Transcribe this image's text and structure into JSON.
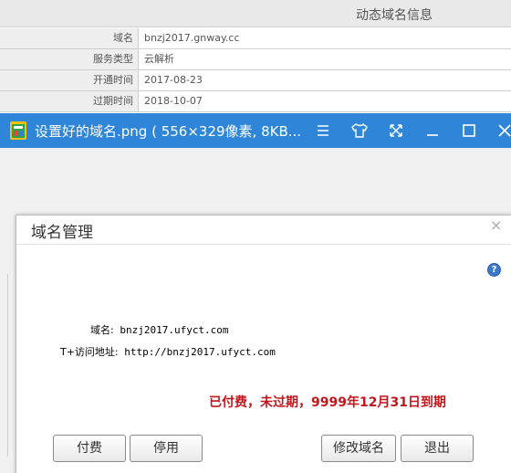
{
  "info_table": {
    "header": "动态域名信息",
    "rows": [
      {
        "label": "域名",
        "value": "bnzj2017.gnway.cc"
      },
      {
        "label": "服务类型",
        "value": "云解析"
      },
      {
        "label": "开通时间",
        "value": "2017-08-23"
      },
      {
        "label": "过期时间",
        "value": "2018-10-07"
      }
    ]
  },
  "viewer": {
    "title": "设置好的域名.png ( 556×329像素, 8KB...",
    "buttons": {
      "menu": "menu-icon",
      "skin": "shirt-icon",
      "fullscreen": "expand-icon",
      "minimize": "minimize-icon",
      "maximize": "maximize-icon",
      "close": "close-icon"
    }
  },
  "dialog": {
    "title": "域名管理",
    "close": "×",
    "help": "?",
    "domain_label": "域名:",
    "domain_value": "bnzj2017.ufyct.com",
    "url_label": "T+访问地址:",
    "url_value": "http://bnzj2017.ufyct.com",
    "status": "已付费，未过期，9999年12月31日到期",
    "buttons": {
      "pay": "付费",
      "disable": "停用",
      "modify": "修改域名",
      "exit": "退出"
    }
  },
  "colors": {
    "titlebar": "#2f86d8",
    "status": "#c3161c"
  }
}
